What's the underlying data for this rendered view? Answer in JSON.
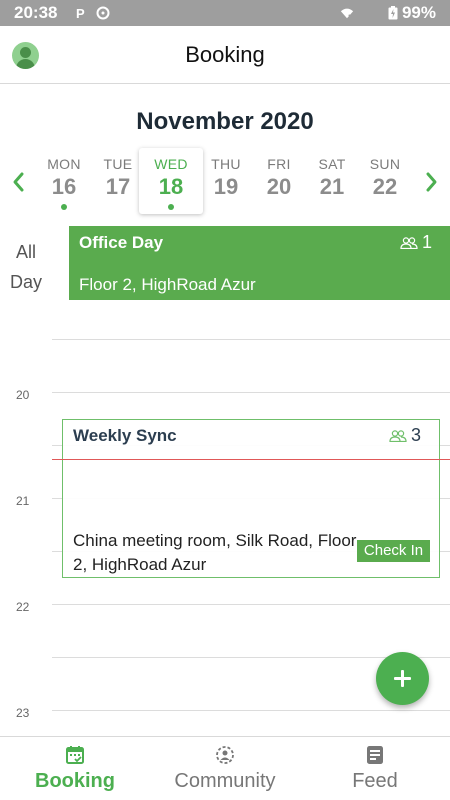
{
  "status_bar": {
    "time": "20:38",
    "battery": "99%"
  },
  "app_bar": {
    "title": "Booking"
  },
  "calendar": {
    "month_label": "November 2020",
    "days": [
      {
        "name": "MON",
        "number": "16",
        "has_event": true,
        "selected": false
      },
      {
        "name": "TUE",
        "number": "17",
        "has_event": false,
        "selected": false
      },
      {
        "name": "WED",
        "number": "18",
        "has_event": true,
        "selected": true
      },
      {
        "name": "THU",
        "number": "19",
        "has_event": false,
        "selected": false
      },
      {
        "name": "FRI",
        "number": "20",
        "has_event": false,
        "selected": false
      },
      {
        "name": "SAT",
        "number": "21",
        "has_event": false,
        "selected": false
      },
      {
        "name": "SUN",
        "number": "22",
        "has_event": false,
        "selected": false
      }
    ]
  },
  "all_day": {
    "label": "All Day",
    "event": {
      "title": "Office Day",
      "attendees": "1",
      "location": "Floor 2, HighRoad Azur"
    }
  },
  "timeline": {
    "hours": [
      "20",
      "21",
      "22",
      "23"
    ],
    "event": {
      "title": "Weekly Sync",
      "attendees": "3",
      "location": "China meeting room, Silk Road, Floor 2, HighRoad Azur",
      "checkin_label": "Check In"
    }
  },
  "bottom_nav": {
    "tabs": [
      {
        "label": "Booking",
        "icon": "calendar-icon",
        "active": true
      },
      {
        "label": "Community",
        "icon": "community-icon",
        "active": false
      },
      {
        "label": "Feed",
        "icon": "feed-icon",
        "active": false
      }
    ]
  },
  "colors": {
    "accent": "#4caf50",
    "status_bar": "#9e9e9e",
    "now_line": "#e05858"
  }
}
